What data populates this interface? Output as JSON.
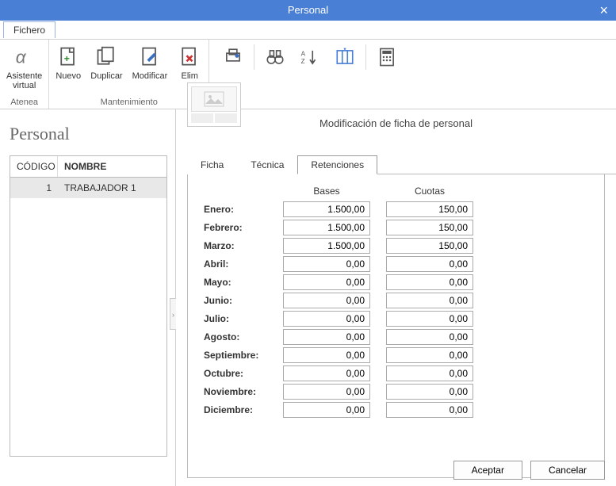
{
  "window_title": "Personal",
  "menu_tab": "Fichero",
  "ribbon": {
    "assistant": "Asistente\nvirtual",
    "assistant_sub": "Atenea",
    "nuevo": "Nuevo",
    "duplicar": "Duplicar",
    "modificar": "Modificar",
    "eliminar": "Elim",
    "group2_label": "Mantenimiento"
  },
  "left_title": "Personal",
  "grid": {
    "col1": "CÓDIGO",
    "col2": "NOMBRE",
    "rows": [
      {
        "codigo": "1",
        "nombre": "TRABAJADOR 1"
      }
    ]
  },
  "right_title": "Modificación de ficha de personal",
  "tabs": [
    "Ficha",
    "Técnica",
    "Retenciones"
  ],
  "active_tab": 2,
  "columns": {
    "bases": "Bases",
    "cuotas": "Cuotas"
  },
  "months": [
    {
      "label": "Enero:",
      "bases": "1.500,00",
      "cuotas": "150,00"
    },
    {
      "label": "Febrero:",
      "bases": "1.500,00",
      "cuotas": "150,00"
    },
    {
      "label": "Marzo:",
      "bases": "1.500,00",
      "cuotas": "150,00"
    },
    {
      "label": "Abril:",
      "bases": "0,00",
      "cuotas": "0,00"
    },
    {
      "label": "Mayo:",
      "bases": "0,00",
      "cuotas": "0,00"
    },
    {
      "label": "Junio:",
      "bases": "0,00",
      "cuotas": "0,00"
    },
    {
      "label": "Julio:",
      "bases": "0,00",
      "cuotas": "0,00"
    },
    {
      "label": "Agosto:",
      "bases": "0,00",
      "cuotas": "0,00"
    },
    {
      "label": "Septiembre:",
      "bases": "0,00",
      "cuotas": "0,00"
    },
    {
      "label": "Octubre:",
      "bases": "0,00",
      "cuotas": "0,00"
    },
    {
      "label": "Noviembre:",
      "bases": "0,00",
      "cuotas": "0,00"
    },
    {
      "label": "Diciembre:",
      "bases": "0,00",
      "cuotas": "0,00"
    }
  ],
  "buttons": {
    "accept": "Aceptar",
    "cancel": "Cancelar"
  }
}
